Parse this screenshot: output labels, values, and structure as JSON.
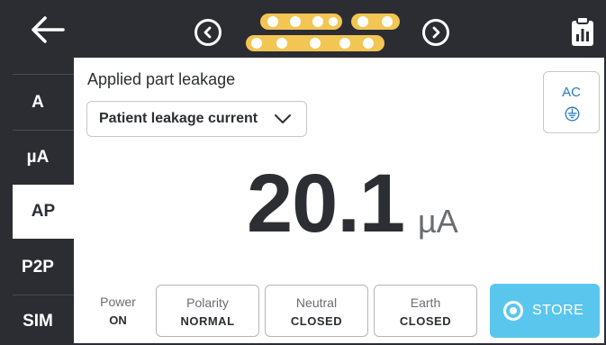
{
  "topbar": {
    "back_icon": "arrow-left-icon",
    "prev_icon": "chevron-left-circle-icon",
    "next_icon": "chevron-right-circle-icon",
    "report_icon": "clipboard-chart-icon",
    "accent_color": "#f3c553"
  },
  "sidebar": {
    "items": [
      {
        "label": "A",
        "active": false
      },
      {
        "label": "µA",
        "active": false
      },
      {
        "label": "AP",
        "active": true
      },
      {
        "label": "P2P",
        "active": false
      },
      {
        "label": "SIM",
        "active": false
      }
    ]
  },
  "main": {
    "title": "Applied part leakage",
    "select_value": "Patient leakage current",
    "ac_button": {
      "label": "AC",
      "icon": "earth-ground-circle-icon"
    },
    "reading": {
      "value": "20.1",
      "unit": "µA"
    }
  },
  "status": {
    "power": {
      "label": "Power",
      "value": "ON"
    },
    "polarity": {
      "label": "Polarity",
      "value": "NORMAL"
    },
    "neutral": {
      "label": "Neutral",
      "value": "CLOSED"
    },
    "earth": {
      "label": "Earth",
      "value": "CLOSED"
    },
    "store": {
      "label": "STORE",
      "color": "#5bc6ed"
    }
  }
}
